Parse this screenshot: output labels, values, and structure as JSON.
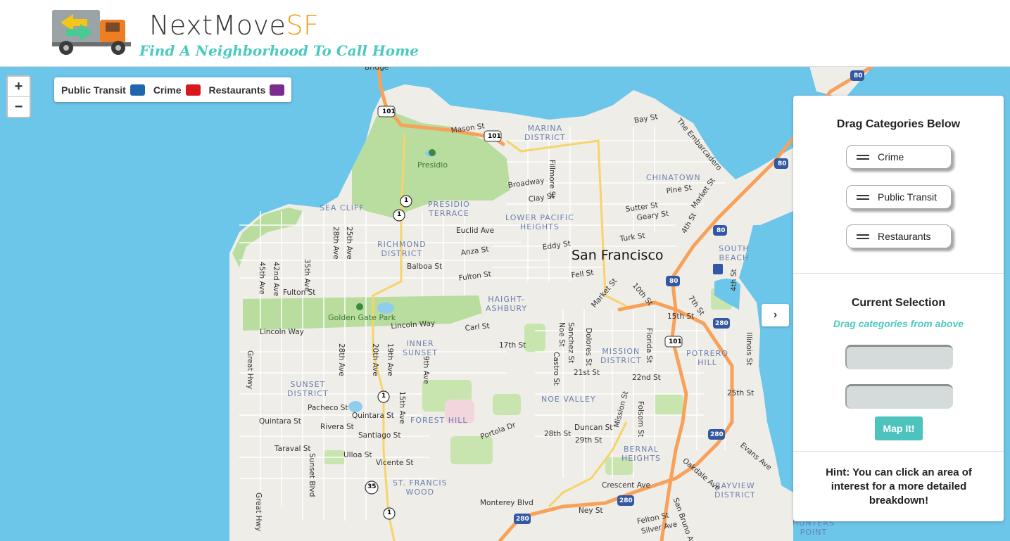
{
  "header": {
    "title_main": "NextMove",
    "title_accent": "SF",
    "tagline": "Find A Neighborhood To Call Home"
  },
  "zoom": {
    "in_label": "+",
    "out_label": "−"
  },
  "legend": {
    "items": [
      {
        "label": "Public Transit",
        "color": "#2166ac"
      },
      {
        "label": "Crime",
        "color": "#d7191c"
      },
      {
        "label": "Restaurants",
        "color": "#7b2d8e"
      }
    ]
  },
  "toggle": {
    "icon": "chevron-right-icon",
    "glyph": "›"
  },
  "panel": {
    "drag_title": "Drag Categories Below",
    "categories": [
      "Crime",
      "Public Transit",
      "Restaurants"
    ],
    "selection_title": "Current Selection",
    "selection_hint": "Drag categories from above",
    "map_button": "Map It!",
    "hint": "Hint: You can click an area of interest for a more detailed breakdown!"
  },
  "map": {
    "city": "San Francisco",
    "districts": {
      "marina": "MARINA\nDISTRICT",
      "chinatown": "CHINATOWN",
      "presidio_terrace": "PRESIDIO\nTERRACE",
      "lower_pac": "LOWER PACIFIC\nHEIGHTS",
      "sea_cliff": "SEA CLIFF",
      "richmond": "RICHMOND\nDISTRICT",
      "south_beach": "SOUTH\nBEACH",
      "haight": "HAIGHT-\nASHBURY",
      "inner_sunset": "INNER\nSUNSET",
      "mission": "MISSION\nDISTRICT",
      "potrero": "POTRERO\nHILL",
      "sunset": "SUNSET\nDISTRICT",
      "noe": "NOE VALLEY",
      "forest_hill": "FOREST HILL",
      "bernal": "BERNAL\nHEIGHTS",
      "st_francis": "ST. FRANCIS\nWOOD",
      "bayview": "BAYVIEW\nDISTRICT",
      "hunters": "HUNTERS\nPOINT"
    },
    "parks": {
      "presidio": "Presidio",
      "ggp": "Golden Gate Park"
    },
    "streets": {
      "mason": "Mason St",
      "bay": "Bay St",
      "embarcadero": "The Embarcadero",
      "broadway": "Broadway",
      "fillmore": "Fillmore St",
      "clay": "Clay St",
      "pine": "Pine St",
      "market_n": "Market St",
      "sutter": "Sutter St",
      "geary": "Geary St",
      "euclid": "Euclid Ave",
      "turk": "Turk St",
      "fourth": "4th St",
      "anza": "Anza St",
      "eddy": "Eddy St",
      "balboa": "Balboa St",
      "fulton_e": "Fulton St",
      "fell": "Fell St",
      "market_c": "Market St",
      "tenth": "10th St",
      "fulton_w": "Fulton St",
      "seventh": "7th St",
      "fourth_s": "4th St",
      "fifteenth": "15th St",
      "lincoln_way": "Lincoln Way",
      "lincoln_way2": "Lincoln Way",
      "carl": "Carl St",
      "seventeenth": "17th St",
      "noe_st": "Noe St",
      "sanchez": "Sanchez St",
      "dolores": "Dolores St",
      "florida": "Florida St",
      "illinois": "Illinois St",
      "castro": "Castro St",
      "twentyfirst": "21st St",
      "twentysecond": "22nd St",
      "twentyfifth": "25th St",
      "great_hwy": "Great Hwy",
      "great_hwy2": "Great Hwy",
      "pacheco": "Pacheco St",
      "quintara": "Quintara St",
      "quintara2": "Quintara St",
      "rivera": "Rivera St",
      "santiago": "Santiago St",
      "portola": "Portola Dr",
      "duncan": "Duncan St",
      "twentyeighth": "28th St",
      "twentyninth": "29th St",
      "folsom": "Folsom St",
      "evans": "Evans Ave",
      "taraval": "Taraval St",
      "ulloa": "Ulloa St",
      "sunset_blvd": "Sunset Blvd",
      "vicente": "Vicente St",
      "oakdale": "Oakdale Ave",
      "mission_st": "Mission St",
      "crescent": "Crescent Ave",
      "monterey": "Monterey Blvd",
      "ney": "Ney St",
      "felton": "Felton St",
      "silver": "Silver Ave",
      "san_bruno": "San Bruno Ave",
      "ave45": "45th Ave",
      "ave42": "42nd Ave",
      "ave35": "35th Ave",
      "ave28": "28th Ave",
      "ave25": "25th Ave",
      "ave28s": "28th Ave",
      "ave20": "20th Ave",
      "ave19": "19th Ave",
      "ave15": "15th Ave",
      "ave9": "9th Ave",
      "bridge": "Bridge"
    },
    "shields": {
      "us101a": "101",
      "us101b": "101",
      "us101c": "101",
      "i80a": "80",
      "i80b": "80",
      "i80c": "80",
      "i80d": "80",
      "i280a": "280",
      "i280b": "280",
      "i280c": "280",
      "i280d": "280",
      "ca1a": "1",
      "ca1b": "1",
      "ca1c": "1",
      "ca1d": "1",
      "ca35": "35"
    }
  }
}
